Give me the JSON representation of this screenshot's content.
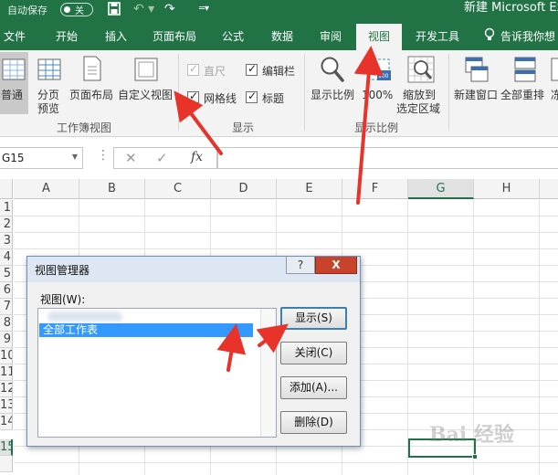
{
  "titlebar": {
    "autosave_label": "自动保存",
    "autosave_state": "关",
    "window_title": "新建 Microsoft Exc"
  },
  "tabs": [
    {
      "label": "文件"
    },
    {
      "label": "开始"
    },
    {
      "label": "插入"
    },
    {
      "label": "页面布局"
    },
    {
      "label": "公式"
    },
    {
      "label": "数据"
    },
    {
      "label": "审阅"
    },
    {
      "label": "视图",
      "active": true
    },
    {
      "label": "开发工具"
    }
  ],
  "tell_me": "告诉我你想",
  "ribbon": {
    "workbook_views": {
      "group_label": "工作簿视图",
      "normal": "普通",
      "page_break_1": "分页",
      "page_break_2": "预览",
      "page_layout": "页面布局",
      "custom_views": "自定义视图"
    },
    "show": {
      "group_label": "显示",
      "ruler": {
        "label": "直尺",
        "checked": true,
        "disabled": true
      },
      "formula_bar": {
        "label": "编辑栏",
        "checked": true
      },
      "gridlines": {
        "label": "网格线",
        "checked": true
      },
      "headings": {
        "label": "标题",
        "checked": true
      }
    },
    "zoom": {
      "group_label": "显示比例",
      "zoom": "显示比例",
      "zoom100": "100%",
      "zoom100_badge": "100",
      "zoom_sel_1": "缩放到",
      "zoom_sel_2": "选定区域"
    },
    "window": {
      "new_window": "新建窗口",
      "arrange_all": "全部重排",
      "freeze": "冻"
    }
  },
  "formula_bar": {
    "name_box": "G15",
    "fx": "fx",
    "cancel": "✕",
    "enter": "✓",
    "content": ""
  },
  "grid": {
    "columns": [
      "A",
      "B",
      "C",
      "D",
      "E",
      "F",
      "G",
      "H"
    ],
    "selected_column": "G",
    "rows": [
      "1",
      "2",
      "3",
      "4",
      "5",
      "6",
      "7",
      "8",
      "9",
      "10",
      "11",
      "12",
      "13",
      "14",
      "15"
    ],
    "selected_row": "15"
  },
  "dialog": {
    "title": "视图管理器",
    "help": "?",
    "close": "X",
    "list_label": "视图(W):",
    "items": [
      "全部工作表"
    ],
    "buttons": {
      "show": "显示(S)",
      "close": "关闭(C)",
      "add": "添加(A)...",
      "delete": "删除(D)"
    }
  },
  "watermark": "Bai 经验",
  "colors": {
    "excel_green": "#217346",
    "annotation_red": "#e8332a",
    "selection_blue": "#3399ff"
  }
}
